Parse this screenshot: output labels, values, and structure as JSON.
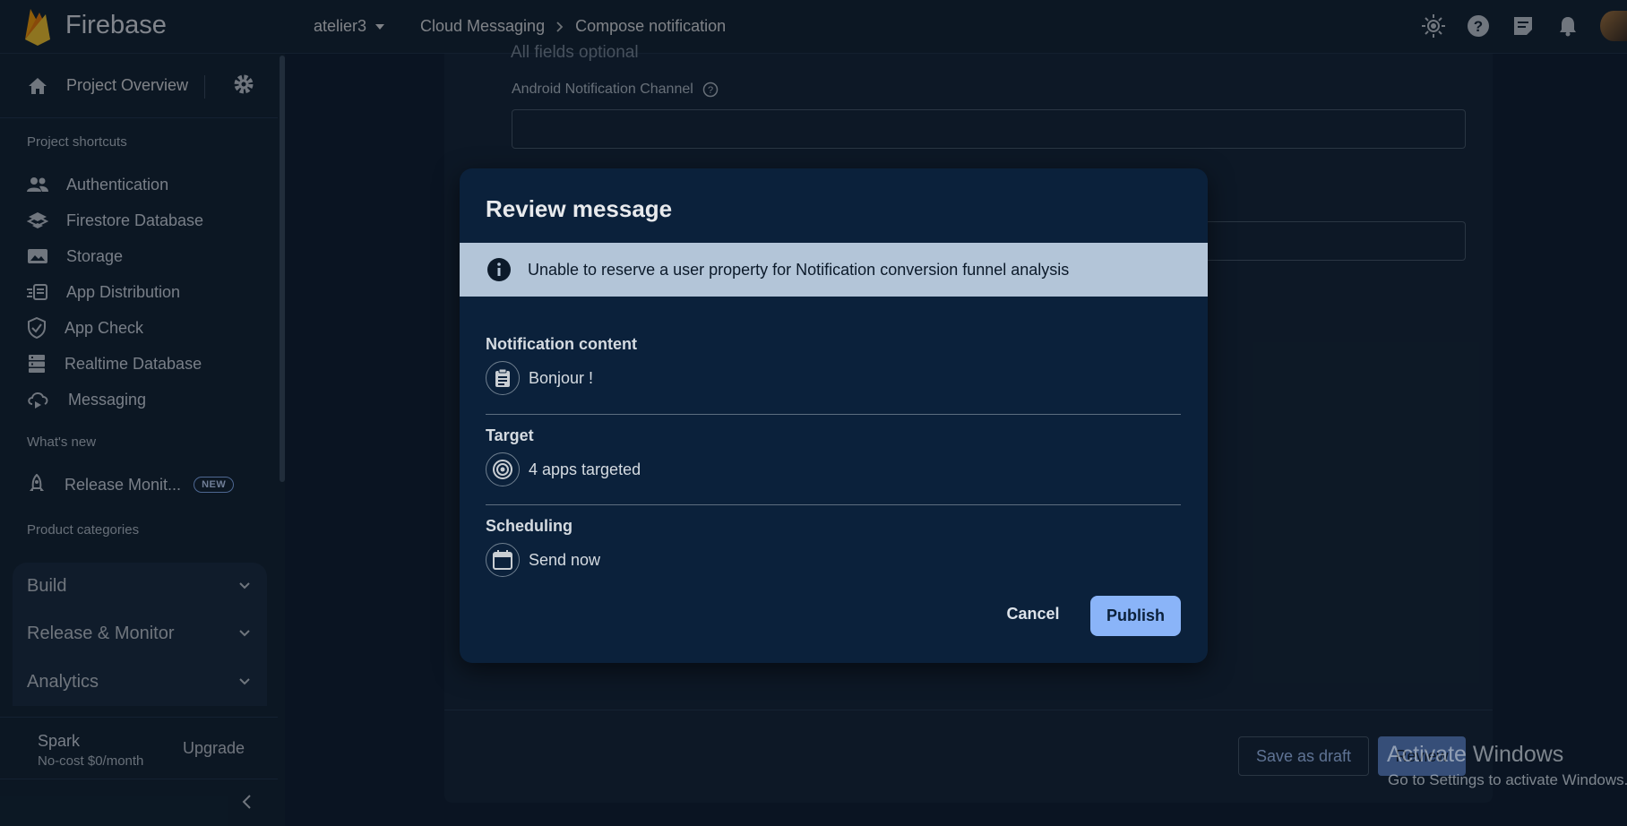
{
  "topbar": {
    "brand": "Firebase",
    "project": "atelier3",
    "breadcrumb": [
      "Cloud Messaging",
      "Compose notification"
    ],
    "icons": [
      "brightness-icon",
      "help-icon",
      "feedback-icon",
      "notifications-icon",
      "avatar"
    ]
  },
  "sidebar": {
    "overview": "Project Overview",
    "shortcuts_title": "Project shortcuts",
    "shortcuts": [
      {
        "label": "Authentication",
        "icon": "people-icon"
      },
      {
        "label": "Firestore Database",
        "icon": "firestore-icon"
      },
      {
        "label": "Storage",
        "icon": "image-icon"
      },
      {
        "label": "App Distribution",
        "icon": "app-distribution-icon"
      },
      {
        "label": "App Check",
        "icon": "shield-icon"
      },
      {
        "label": "Realtime Database",
        "icon": "database-icon"
      },
      {
        "label": "Messaging",
        "icon": "cloud-messaging-icon"
      }
    ],
    "whats_new_title": "What's new",
    "whats_new": {
      "label": "Release Monit...",
      "badge": "NEW"
    },
    "categories_title": "Product categories",
    "categories": [
      "Build",
      "Release & Monitor",
      "Analytics"
    ],
    "plan": {
      "name": "Spark",
      "price": "No-cost $0/month",
      "upgrade": "Upgrade"
    }
  },
  "main": {
    "fields_optional": "All fields optional",
    "channel_label": "Android Notification Channel",
    "channel_value": "",
    "save_draft": "Save as draft",
    "review": "Review"
  },
  "dialog": {
    "title": "Review message",
    "banner": "Unable to reserve a user property for Notification conversion funnel analysis",
    "sections": [
      {
        "heading": "Notification content",
        "value": "Bonjour !",
        "icon": "clipboard-icon"
      },
      {
        "heading": "Target",
        "value": "4 apps targeted",
        "icon": "target-icon"
      },
      {
        "heading": "Scheduling",
        "value": "Send now",
        "icon": "calendar-icon"
      }
    ],
    "cancel": "Cancel",
    "publish": "Publish"
  },
  "watermark": {
    "title": "Activate Windows",
    "subtitle": "Go to Settings to activate Windows."
  },
  "colors": {
    "background": "#0f1d2c",
    "dialog": "#0b213b",
    "banner": "#b3c5d8",
    "primary": "#8ab4f8"
  }
}
